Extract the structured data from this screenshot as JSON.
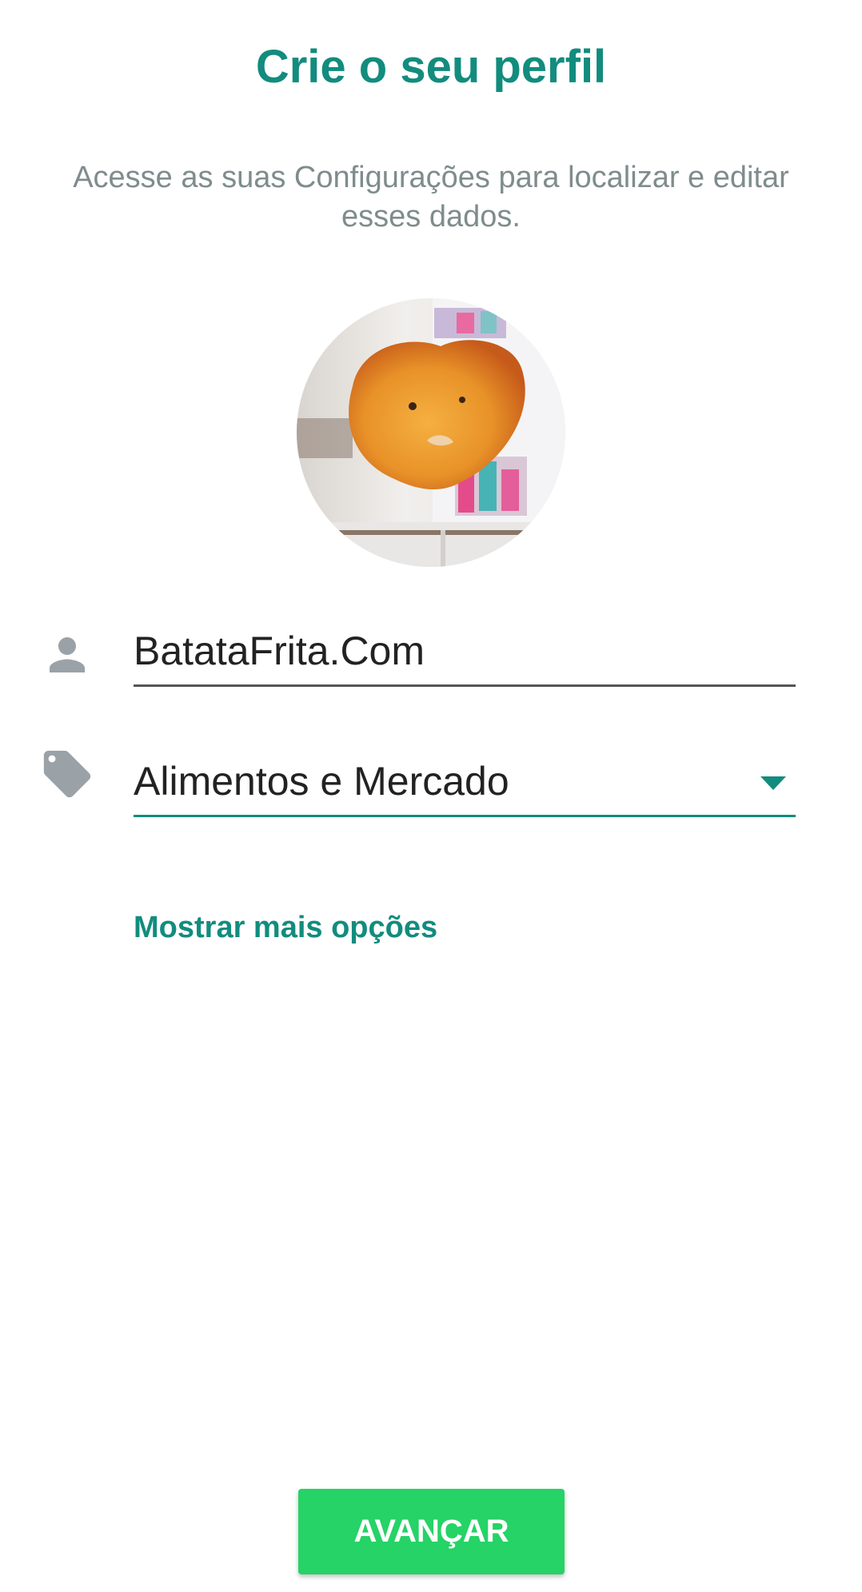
{
  "header": {
    "title": "Crie o seu perfil",
    "subtitle": "Acesse as suas Configurações para localizar e editar esses dados."
  },
  "profile": {
    "photo_icon": "profile-photo",
    "name_icon": "person-icon",
    "name_value": "BatataFrita.Com",
    "category_icon": "tag-icon",
    "category_value": "Alimentos e Mercado",
    "category_dropdown_icon": "dropdown-arrow-icon"
  },
  "links": {
    "more_options": "Mostrar mais opções"
  },
  "footer": {
    "next_label": "AVANÇAR"
  },
  "colors": {
    "accent": "#128c7e",
    "button": "#25d366",
    "subtitle": "#7f8c8d",
    "icon": "#9aa2a8"
  }
}
